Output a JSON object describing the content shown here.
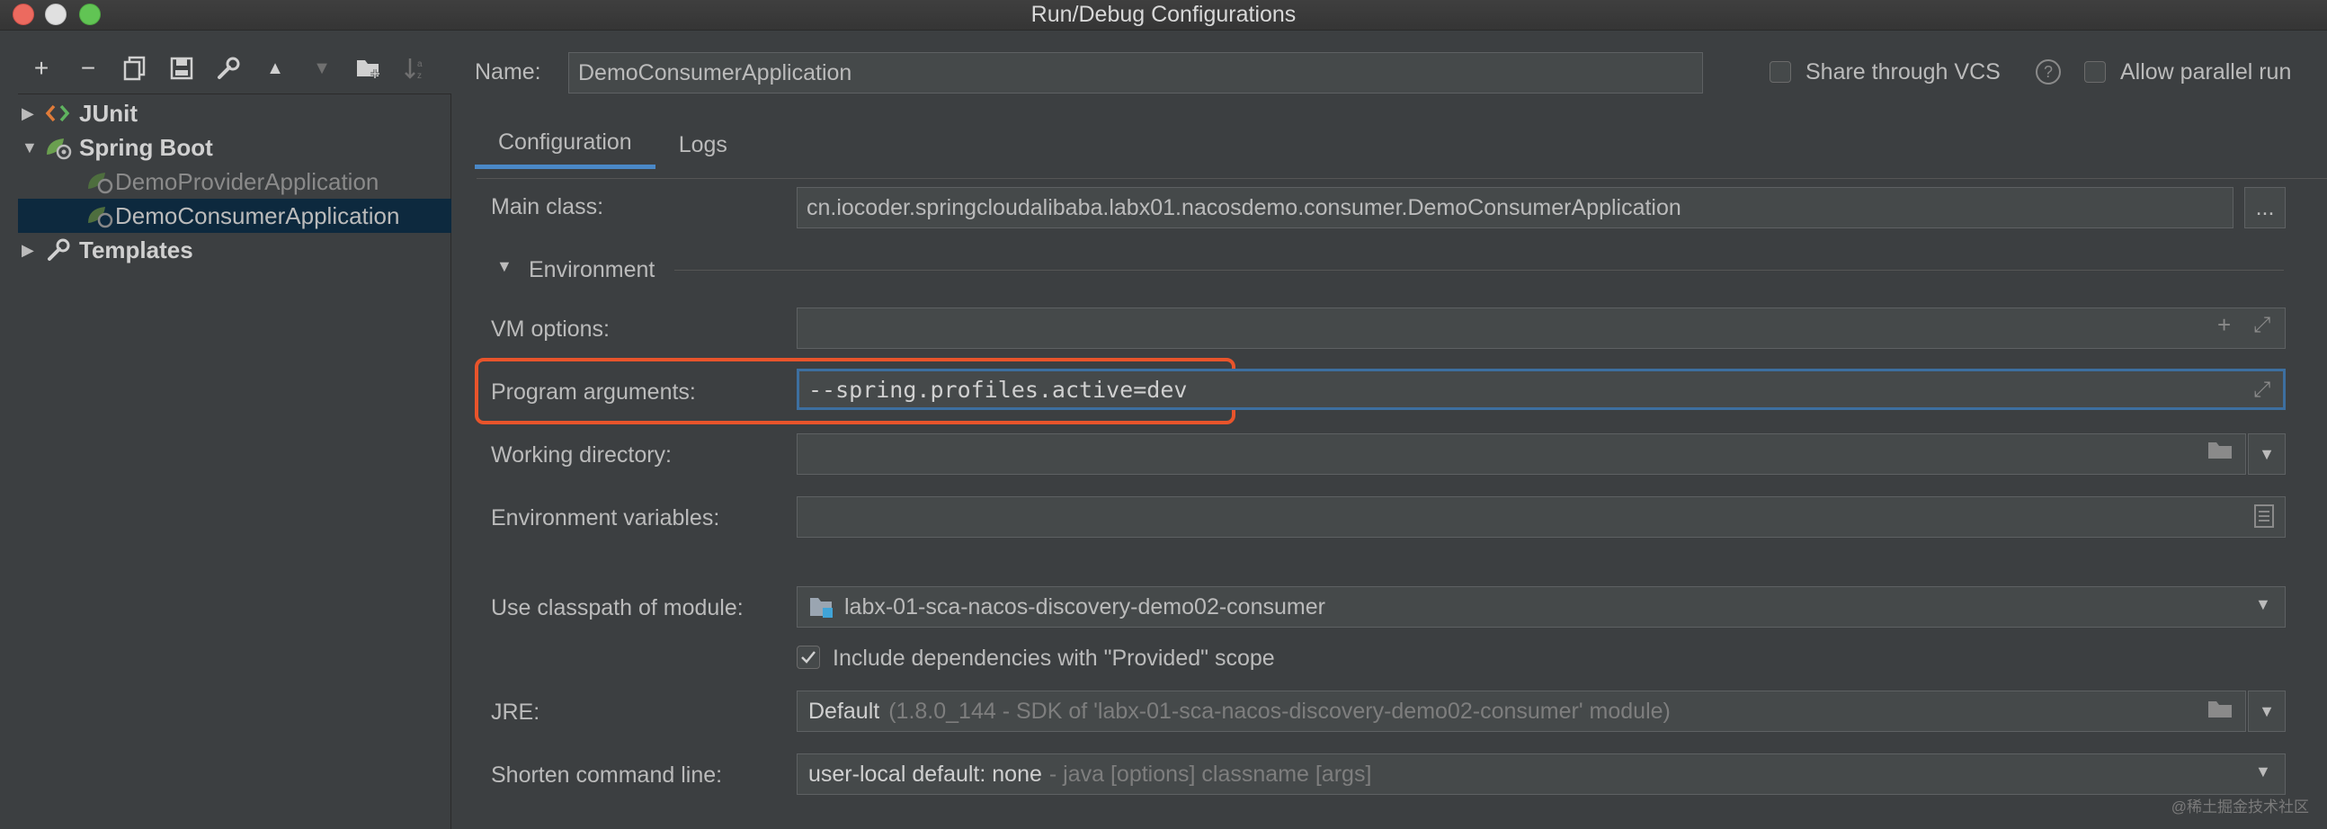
{
  "window": {
    "title": "Run/Debug Configurations"
  },
  "toolbar": {
    "add_icon": "+",
    "remove_icon": "−",
    "copy_icon": "copy-icon",
    "save_icon": "save-icon",
    "edit_icon": "wrench-icon",
    "up_icon": "▲",
    "down_icon": "▼",
    "folder_icon": "folder-add-icon",
    "sort_icon": "sort-icon"
  },
  "tree": {
    "junit": "JUnit",
    "spring_boot": "Spring Boot",
    "provider": "DemoProviderApplication",
    "consumer": "DemoConsumerApplication",
    "templates": "Templates"
  },
  "header": {
    "name_label": "Name:",
    "name_value": "DemoConsumerApplication",
    "share_label": "Share through VCS",
    "help_icon": "?",
    "parallel_label": "Allow parallel run"
  },
  "tabs": [
    "Configuration",
    "Logs"
  ],
  "form": {
    "main_class_label": "Main class:",
    "main_class_value": "cn.iocoder.springcloudalibaba.labx01.nacosdemo.consumer.DemoConsumerApplication",
    "browse_label": "...",
    "environment_label": "Environment",
    "vm_options_label": "VM options:",
    "program_args_label": "Program arguments:",
    "program_args_value": "--spring.profiles.active=dev",
    "working_dir_label": "Working directory:",
    "env_vars_label": "Environment variables:",
    "classpath_label": "Use classpath of module:",
    "classpath_value": "labx-01-sca-nacos-discovery-demo02-consumer",
    "include_deps_label": "Include dependencies with \"Provided\" scope",
    "jre_label": "JRE:",
    "jre_value": "Default",
    "jre_detail": "(1.8.0_144 - SDK of 'labx-01-sca-nacos-discovery-demo02-consumer' module)",
    "shorten_label": "Shorten command line:",
    "shorten_value": "user-local default: none",
    "shorten_detail": "- java [options] classname [args]"
  },
  "watermark": "@稀土掘金技术社区",
  "colors": {
    "accent": "#4a88c7",
    "highlight": "#e8542b",
    "selection": "#0d293e"
  }
}
